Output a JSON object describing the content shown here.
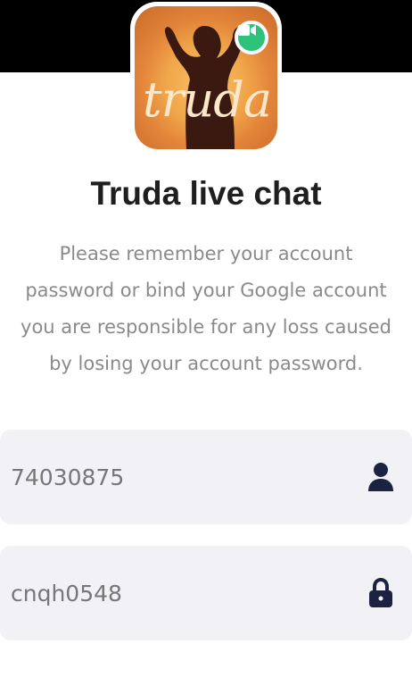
{
  "app": {
    "logo_text": "truda",
    "title": "Truda live chat",
    "notice": "Please remember your account\npassword or bind your Google account\nyou are responsible for any loss caused\nby losing your account password."
  },
  "form": {
    "username": {
      "value": "74030875",
      "icon": "user-icon"
    },
    "password": {
      "value": "cnqh0548",
      "icon": "lock-icon"
    }
  },
  "colors": {
    "top_band": "#000000",
    "title": "#1f1f1f",
    "notice": "#8a8a8a",
    "field_bg": "#f2f2f6",
    "icon": "#1c2340",
    "badge": "#2bc37a"
  }
}
